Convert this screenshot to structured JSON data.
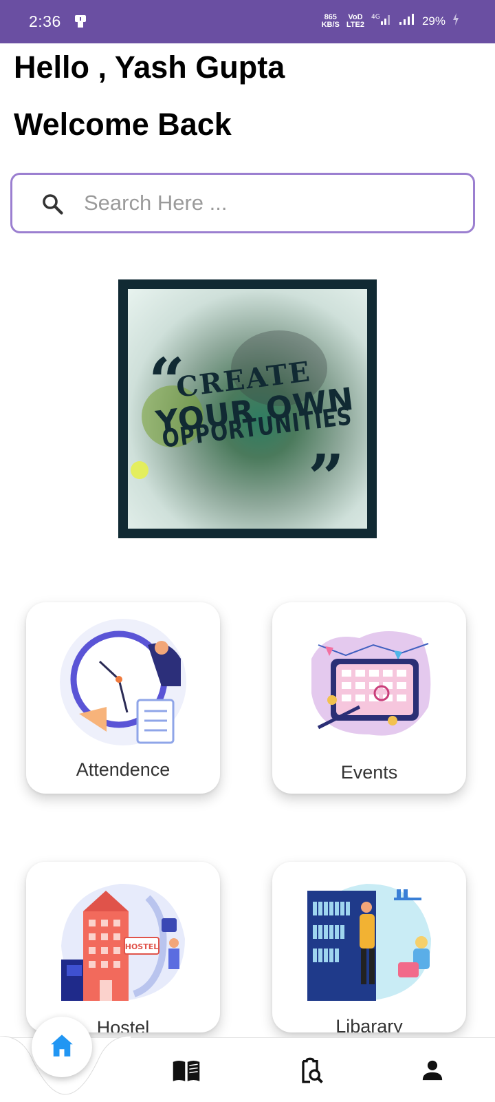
{
  "status_bar": {
    "time": "2:36",
    "net_speed_value": "865",
    "net_speed_unit": "KB/S",
    "volte_top": "VoD",
    "volte_bottom": "LTE2",
    "network_type": "4G",
    "battery_percent": "29%"
  },
  "header": {
    "greeting": "Hello , Yash Gupta",
    "welcome": "Welcome Back"
  },
  "search": {
    "placeholder": "Search Here ..."
  },
  "banner": {
    "open_quote": "“",
    "line1": "CREATE",
    "line2": "YOUR OWN",
    "line3": "OPPORTUNITIES",
    "close_quote": "”"
  },
  "menu": [
    {
      "label": "Attendence",
      "icon": "clock-checklist-illustration"
    },
    {
      "label": "Events",
      "icon": "calendar-event-illustration"
    },
    {
      "label": "Hostel",
      "icon": "hostel-building-illustration"
    },
    {
      "label": "Libarary",
      "icon": "library-bookshelf-illustration"
    }
  ],
  "bottom_nav": {
    "items": [
      "home-icon",
      "book-icon",
      "clipboard-search-icon",
      "profile-icon"
    ],
    "active": "home-icon",
    "active_color": "#2196f3"
  },
  "colors": {
    "status_bar": "#6a4fa2",
    "search_border": "#9b7fd0"
  }
}
